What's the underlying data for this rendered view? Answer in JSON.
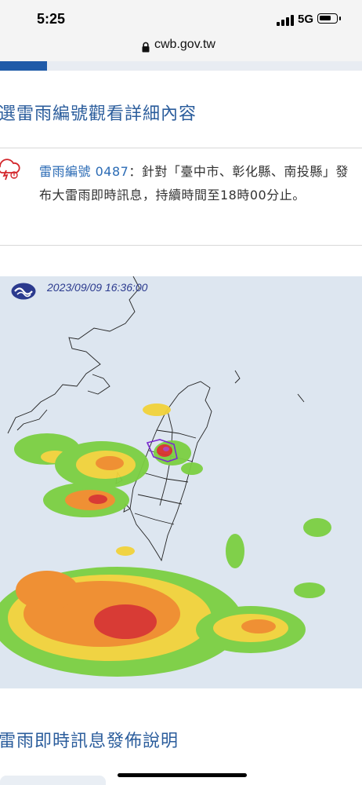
{
  "status_bar": {
    "time": "5:25",
    "network": "5G"
  },
  "browser": {
    "url": "cwb.gov.tw",
    "progress": 0.13
  },
  "heading_select": "選雷雨編號觀看詳細內容",
  "alert": {
    "link_text": "雷雨編號  0487",
    "message": "：針對「臺中市、彰化縣、南投縣」發布大雷雨即時訊息，持續時間至18時00分止。"
  },
  "radar": {
    "timestamp": "2023/09/09 16:36:00"
  },
  "heading_release": "雷雨即時訊息發佈說明",
  "colors": {
    "heading": "#2b5d9c",
    "link": "#2b6bb5",
    "progress": "#1f5aa8",
    "radar_background": "#dde6f0"
  },
  "icons": [
    "lock-icon",
    "thunderstorm-alert-icon",
    "cwb-logo-icon"
  ]
}
